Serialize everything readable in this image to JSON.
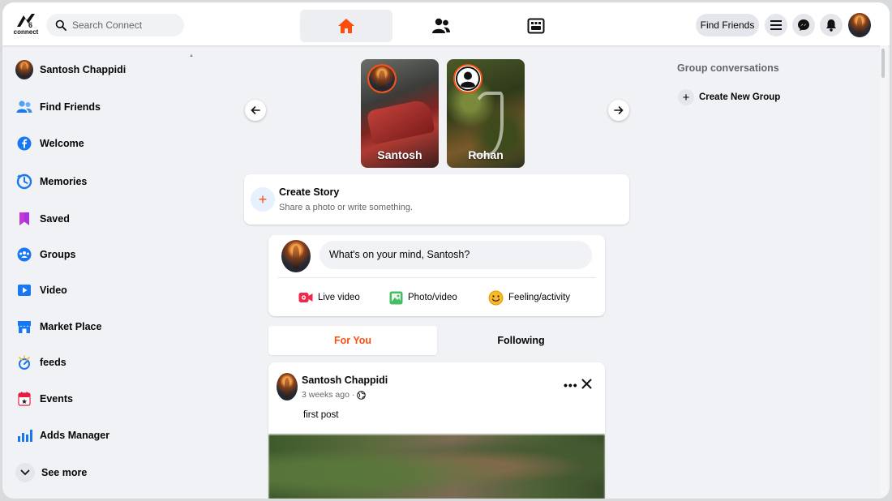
{
  "app": {
    "logo_text": "connect"
  },
  "search": {
    "placeholder": "Search Connect"
  },
  "nav": {
    "tabs": [
      {
        "icon": "home-icon",
        "active": true
      },
      {
        "icon": "friends-icon",
        "active": false
      },
      {
        "icon": "watch-icon",
        "active": false
      }
    ]
  },
  "top_right": {
    "find_friends_label": "Find Friends",
    "menu_icon": "menu-icon",
    "messenger_icon": "messenger-icon",
    "bell_icon": "bell-icon"
  },
  "sidebar": {
    "items": [
      {
        "label": "Santosh Chappidi",
        "icon": "avatar"
      },
      {
        "label": "Find Friends",
        "icon": "find-friends-icon"
      },
      {
        "label": "Welcome",
        "icon": "welcome-icon"
      },
      {
        "label": "Memories",
        "icon": "memories-icon"
      },
      {
        "label": "Saved",
        "icon": "saved-icon"
      },
      {
        "label": "Groups",
        "icon": "groups-icon"
      },
      {
        "label": "Video",
        "icon": "video-icon"
      },
      {
        "label": "Market Place",
        "icon": "marketplace-icon"
      },
      {
        "label": "feeds",
        "icon": "feeds-icon"
      },
      {
        "label": "Events",
        "icon": "events-icon"
      },
      {
        "label": "Adds Manager",
        "icon": "ads-manager-icon"
      },
      {
        "label": "See more",
        "icon": "chevron-down-icon"
      }
    ]
  },
  "stories": {
    "items": [
      {
        "name": "Santosh"
      },
      {
        "name": "Rohan"
      }
    ],
    "create": {
      "title": "Create Story",
      "subtitle": "Share a photo or write something."
    }
  },
  "composer": {
    "placeholder": "What's on your mind, Santosh?",
    "actions": [
      {
        "label": "Live video",
        "icon": "live-video-icon"
      },
      {
        "label": "Photo/video",
        "icon": "photo-video-icon"
      },
      {
        "label": "Feeling/activity",
        "icon": "feeling-icon"
      }
    ]
  },
  "feed_tabs": {
    "for_you": "For You",
    "following": "Following"
  },
  "post": {
    "author": "Santosh Chappidi",
    "time": "3 weeks ago ·",
    "text": "first post"
  },
  "right_column": {
    "title": "Group conversations",
    "create_group": "Create New Group"
  },
  "colors": {
    "accent": "#ff4d0e",
    "background": "#f0f2f5",
    "surface": "#ffffff",
    "text": "#050505",
    "muted": "#65676b"
  }
}
